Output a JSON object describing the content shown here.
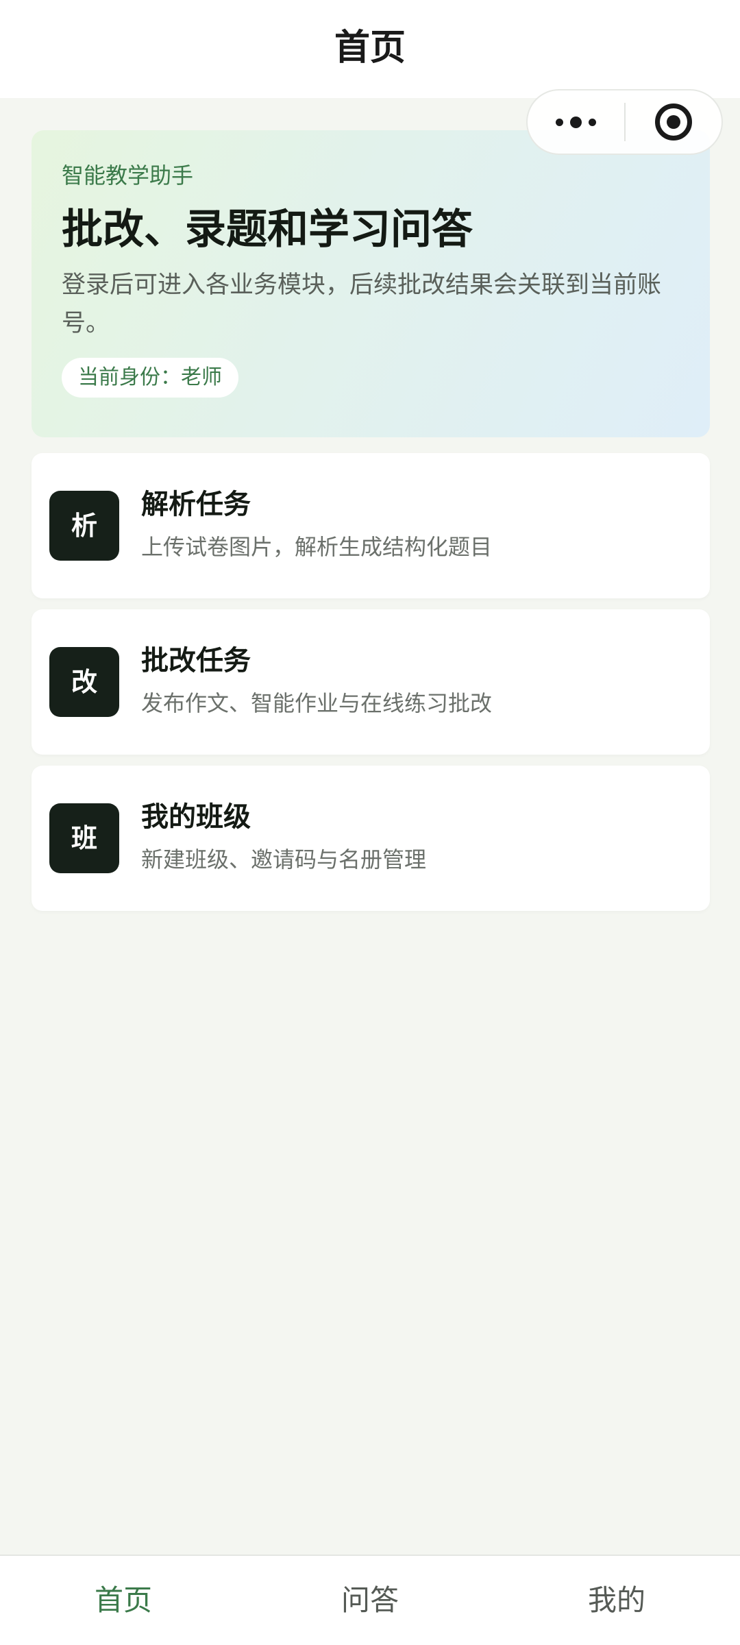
{
  "navbar": {
    "title": "首页"
  },
  "capsule": {
    "more_icon": "more-dots-icon",
    "close_icon": "target-close-icon"
  },
  "hero": {
    "tag": "智能教学助手",
    "title": "批改、录题和学习问答",
    "description": "登录后可进入各业务模块，后续批改结果会关联到当前账号。",
    "role": "当前身份：老师",
    "accent_color": "#3b7a4a"
  },
  "menu": [
    {
      "icon_text": "析",
      "title": "解析任务",
      "desc": "上传试卷图片，解析生成结构化题目"
    },
    {
      "icon_text": "改",
      "title": "批改任务",
      "desc": "发布作文、智能作业与在线练习批改"
    },
    {
      "icon_text": "班",
      "title": "我的班级",
      "desc": "新建班级、邀请码与名册管理"
    }
  ],
  "tabbar": {
    "tabs": [
      {
        "label": "首页",
        "active": true
      },
      {
        "label": "问答",
        "active": false
      },
      {
        "label": "我的",
        "active": false
      }
    ],
    "active_color": "#3b7a4a"
  }
}
